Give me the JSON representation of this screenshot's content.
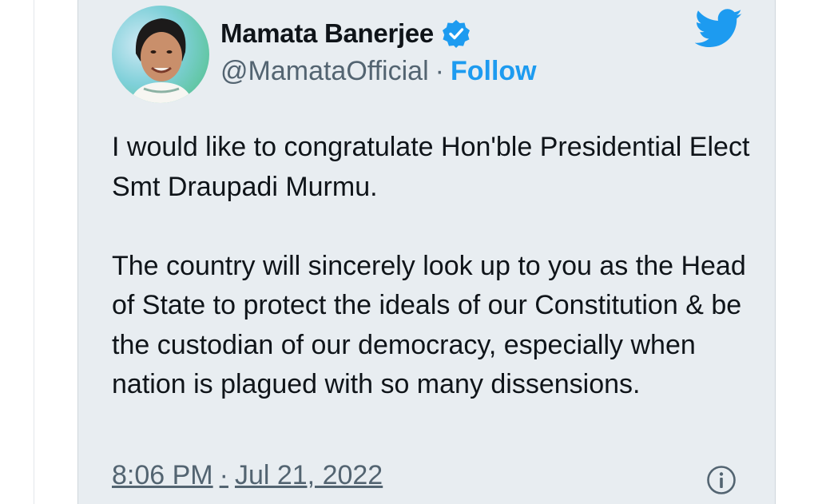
{
  "author": {
    "display_name": "Mamata Banerjee",
    "handle": "@MamataOfficial",
    "separator": "·",
    "follow_label": "Follow",
    "verified": true,
    "avatar_icon": "profile-photo"
  },
  "tweet": {
    "paragraphs": [
      "I would like to congratulate Hon'ble Presidential Elect Smt Draupadi Murmu.",
      "The country will sincerely look up to you as the Head of State to protect the ideals of our Constitution & be the custodian of our democracy, especially when nation is plagued with so many dissensions."
    ]
  },
  "meta": {
    "time": "8:06 PM",
    "separator": "·",
    "date": "Jul 21, 2022"
  },
  "icons": {
    "brand": "twitter-bird-icon",
    "verified": "verified-badge-icon",
    "info": "info-icon"
  },
  "colors": {
    "card_bg": "#e8edf1",
    "accent": "#1d9bf0",
    "text": "#0f1419",
    "muted": "#536471"
  }
}
